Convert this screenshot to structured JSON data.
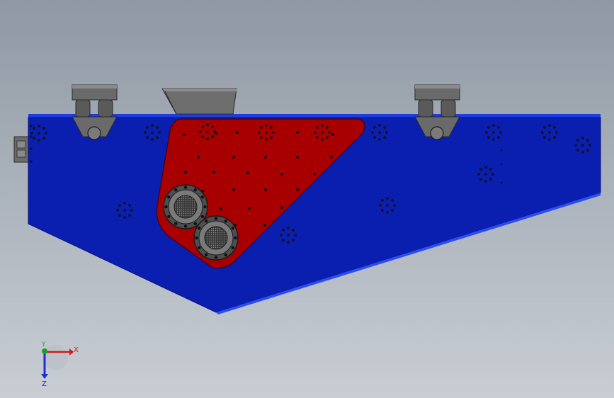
{
  "viewport": {
    "background_top": "#8f98a3",
    "background_bottom": "#c9ced4"
  },
  "model": {
    "body_color": "#0a1fb0",
    "body_edge_color": "#1f3ce0",
    "side_plate_color": "#a80000",
    "hardware_color": "#5e5e5e",
    "hole_color": "#101010"
  },
  "triad": {
    "x_label": "X",
    "y_label": "Y",
    "z_label": "Z",
    "x_color": "#d41a1a",
    "y_color": "#1aa31a",
    "z_color": "#1a2fd4"
  }
}
